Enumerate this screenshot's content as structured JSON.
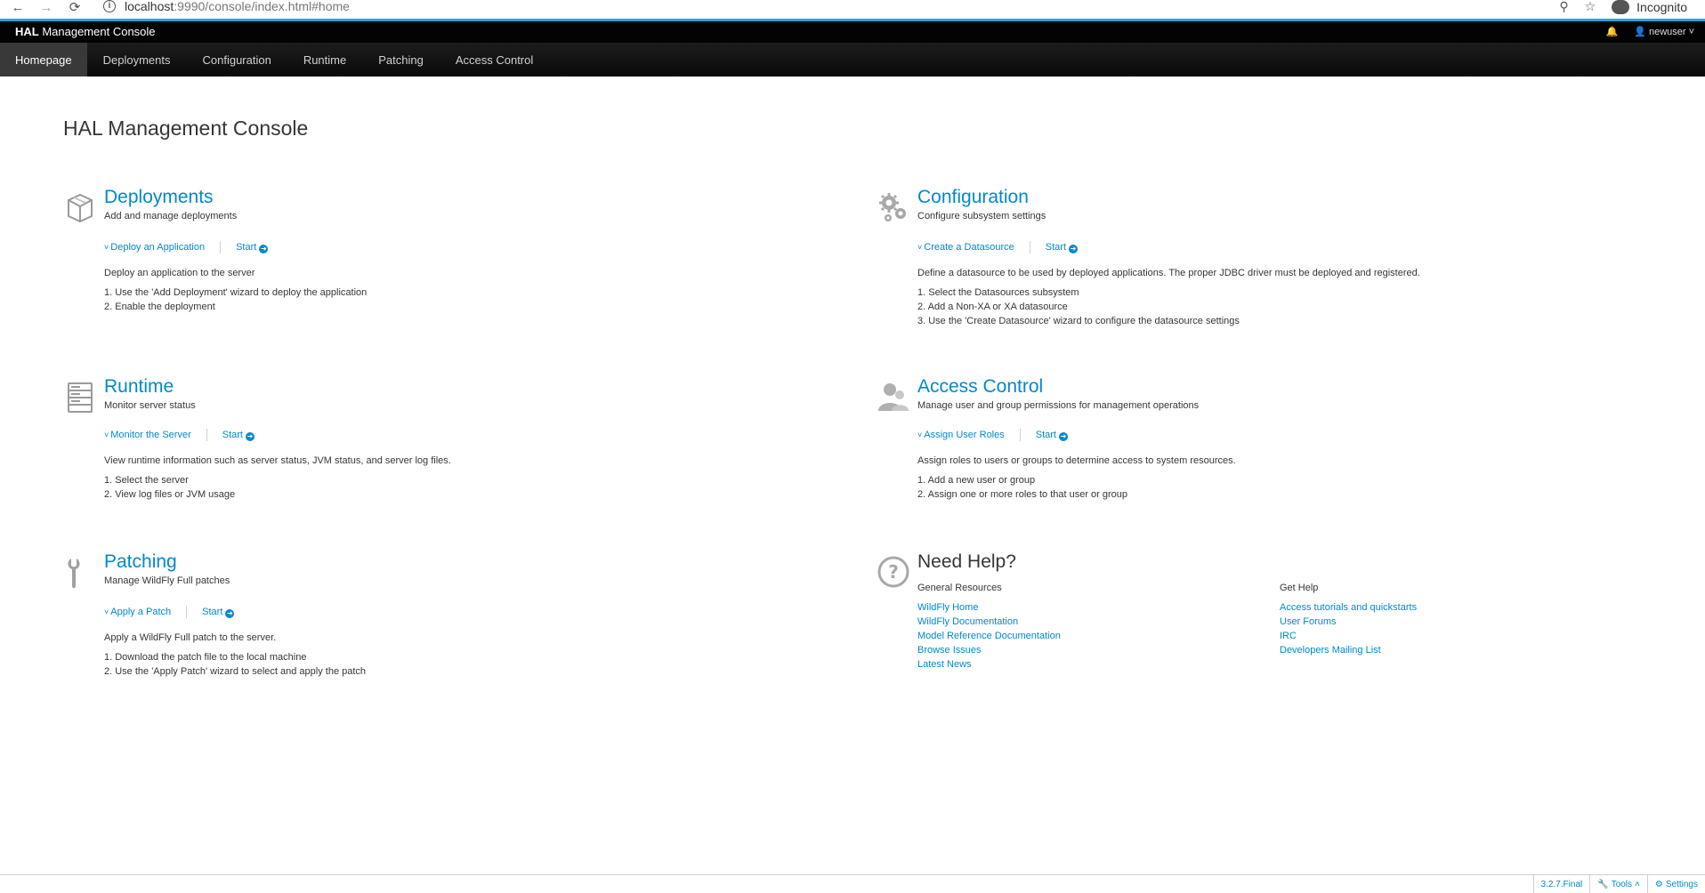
{
  "browser": {
    "url_host": "localhost",
    "url_rest": ":9990/console/index.html#home",
    "incognito_label": "Incognito",
    "back_glyph": "←",
    "forward_glyph": "→",
    "reload_glyph": "⟳"
  },
  "header": {
    "brand_bold": "HAL",
    "brand_rest": " Management Console",
    "user": "newuser"
  },
  "nav": {
    "items": [
      {
        "label": "Homepage",
        "active": true
      },
      {
        "label": "Deployments"
      },
      {
        "label": "Configuration"
      },
      {
        "label": "Runtime"
      },
      {
        "label": "Patching"
      },
      {
        "label": "Access Control"
      }
    ]
  },
  "page": {
    "title": "HAL Management Console"
  },
  "sections": {
    "deployments": {
      "title": "Deployments",
      "subtitle": "Add and manage deployments",
      "action": "Deploy an Application",
      "start": "Start",
      "description": "Deploy an application to the server",
      "steps": [
        "1. Use the 'Add Deployment' wizard to deploy the application",
        "2. Enable the deployment"
      ]
    },
    "configuration": {
      "title": "Configuration",
      "subtitle": "Configure subsystem settings",
      "action": "Create a Datasource",
      "start": "Start",
      "description": "Define a datasource to be used by deployed applications. The proper JDBC driver must be deployed and registered.",
      "steps": [
        "1. Select the Datasources subsystem",
        "2. Add a Non-XA or XA datasource",
        "3. Use the 'Create Datasource' wizard to configure the datasource settings"
      ]
    },
    "runtime": {
      "title": "Runtime",
      "subtitle": "Monitor server status",
      "action": "Monitor the Server",
      "start": "Start",
      "description": "View runtime information such as server status, JVM status, and server log files.",
      "steps": [
        "1. Select the server",
        "2. View log files or JVM usage"
      ]
    },
    "access_control": {
      "title": "Access Control",
      "subtitle": "Manage user and group permissions for management operations",
      "action": "Assign User Roles",
      "start": "Start",
      "description": "Assign roles to users or groups to determine access to system resources.",
      "steps": [
        "1. Add a new user or group",
        "2. Assign one or more roles to that user or group"
      ]
    },
    "patching": {
      "title": "Patching",
      "subtitle": "Manage WildFly Full patches",
      "action": "Apply a Patch",
      "start": "Start",
      "description": "Apply a WildFly Full patch to the server.",
      "steps": [
        "1. Download the patch file to the local machine",
        "2. Use the 'Apply Patch' wizard to select and apply the patch"
      ]
    }
  },
  "help": {
    "title": "Need Help?",
    "general_heading": "General Resources",
    "general_links": [
      "WildFly Home",
      "WildFly Documentation",
      "Model Reference Documentation",
      "Browse Issues",
      "Latest News"
    ],
    "get_heading": "Get Help",
    "get_links": [
      "Access tutorials and quickstarts",
      "User Forums",
      "IRC",
      "Developers Mailing List"
    ]
  },
  "footer": {
    "version": "3.2.7.Final",
    "tools": "Tools",
    "settings": "Settings"
  },
  "colors": {
    "link": "#0088ce",
    "nav_bg": "#0a0a0a",
    "nav_active": "#393939"
  }
}
